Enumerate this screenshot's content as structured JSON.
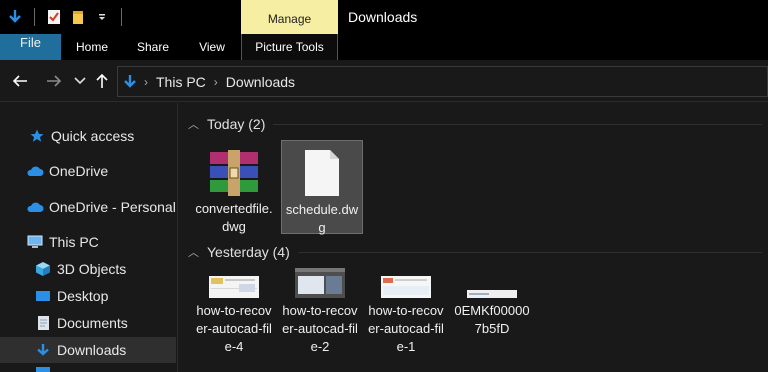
{
  "window": {
    "title": "Downloads"
  },
  "ribbon": {
    "context_group": "Manage",
    "tabs": {
      "file": "File",
      "home": "Home",
      "share": "Share",
      "view": "View",
      "picture_tools": "Picture Tools"
    }
  },
  "address": {
    "crumb1": "This PC",
    "crumb2": "Downloads"
  },
  "sidebar": {
    "quick_access": "Quick access",
    "onedrive": "OneDrive",
    "onedrive_personal": "OneDrive - Personal",
    "this_pc": "This PC",
    "objects3d": "3D Objects",
    "desktop": "Desktop",
    "documents": "Documents",
    "downloads": "Downloads"
  },
  "groups": {
    "today": {
      "label": "Today (2)"
    },
    "yesterday": {
      "label": "Yesterday (4)"
    }
  },
  "files": {
    "today": [
      {
        "name": "convertedfile.dwg",
        "icon": "winrar-archive-icon"
      },
      {
        "name": "schedule.dwg",
        "icon": "blank-file-icon"
      }
    ],
    "yesterday": [
      {
        "name": "how-to-recover-autocad-file-4",
        "icon": "screenshot-thumbnail"
      },
      {
        "name": "how-to-recover-autocad-file-2",
        "icon": "screenshot-thumbnail"
      },
      {
        "name": "how-to-recover-autocad-file-1",
        "icon": "screenshot-thumbnail"
      },
      {
        "name": "0EMKf000007b5fD",
        "icon": "screenshot-thumbnail"
      }
    ]
  },
  "colors": {
    "file_tab": "#1f6e9c",
    "manage_tab": "#f6eea2",
    "accent_blue": "#2b8fe6"
  }
}
